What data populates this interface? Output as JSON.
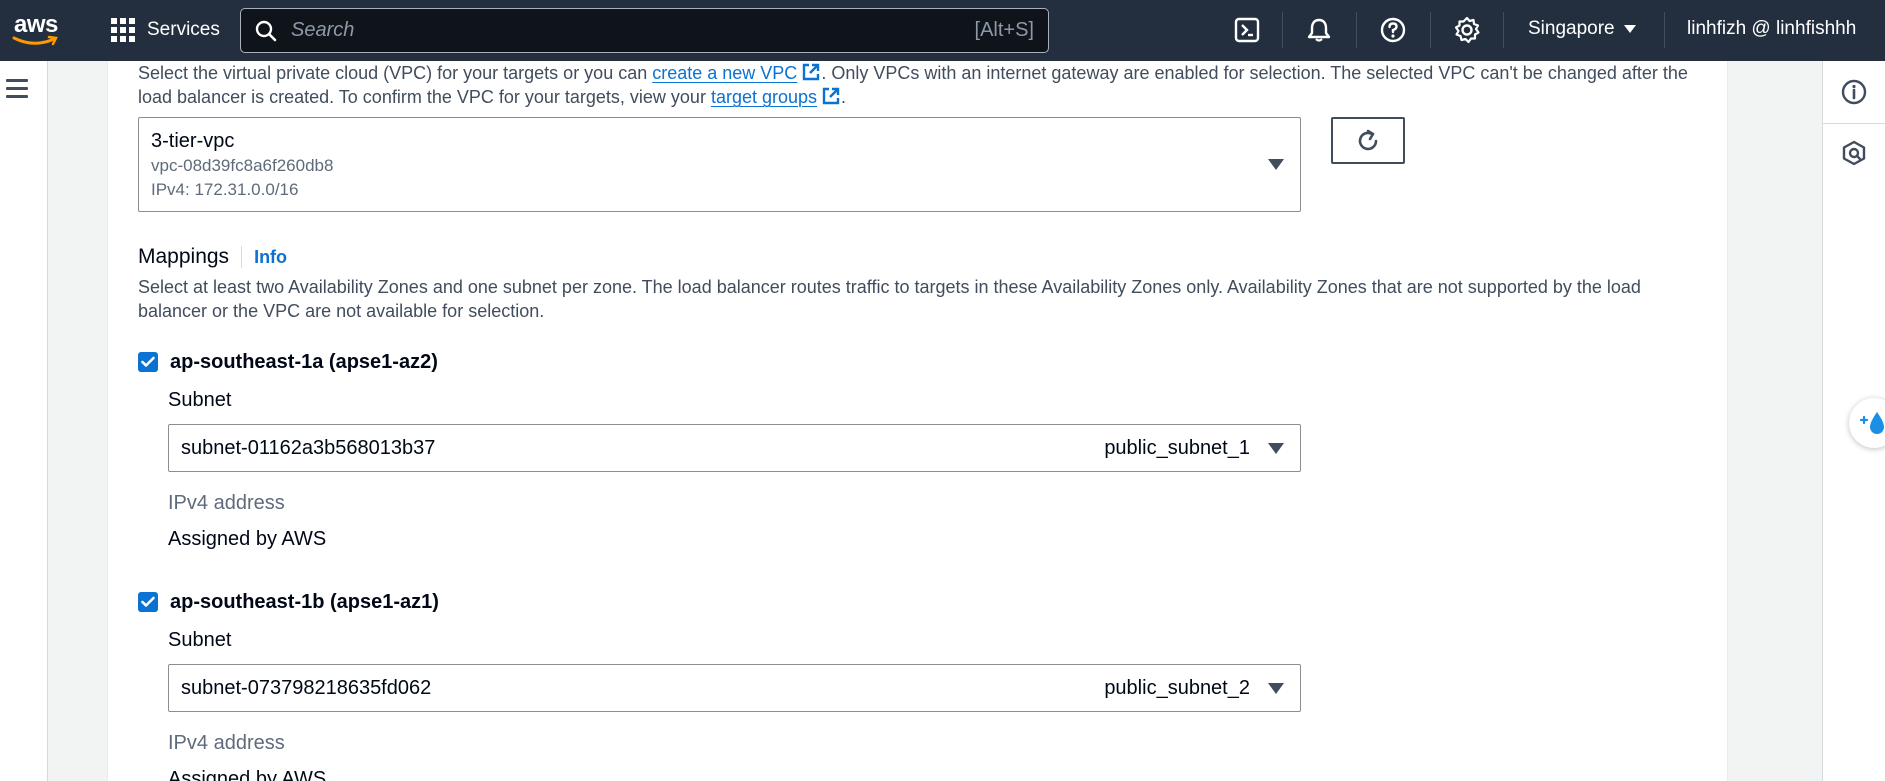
{
  "topnav": {
    "logo_text": "aws",
    "services_label": "Services",
    "search_placeholder": "Search",
    "search_shortcut": "[Alt+S]",
    "region": "Singapore",
    "account": "linhfizh @ linhfishhh"
  },
  "icons": {
    "grid": "grid-icon",
    "search": "search-icon",
    "cloudshell": "terminal-icon",
    "notifications": "bell-icon",
    "help": "help-icon",
    "settings": "gear-icon",
    "menu": "menu-icon",
    "info": "info-icon",
    "feedback": "feedback-icon",
    "refresh": "refresh-icon",
    "external_link": "external-link-icon"
  },
  "colors": {
    "nav_bg": "#232f3e",
    "link": "#0972d3",
    "checkbox": "#0972d3"
  },
  "vpc": {
    "desc_part1": "Select the virtual private cloud (VPC) for your targets or you can ",
    "create_vpc_link": "create a new VPC",
    "desc_part2": ". Only VPCs with an internet gateway are enabled for selection. The selected VPC can't be changed after the load balancer is created. To confirm the VPC for your targets, view your ",
    "target_groups_link": "target groups",
    "desc_part3": ".",
    "selected_name": "3-tier-vpc",
    "selected_id": "vpc-08d39fc8a6f260db8",
    "selected_cidr": "IPv4: 172.31.0.0/16"
  },
  "mappings": {
    "title": "Mappings",
    "info_label": "Info",
    "description": "Select at least two Availability Zones and one subnet per zone. The load balancer routes traffic to targets in these Availability Zones only. Availability Zones that are not supported by the load balancer or the VPC are not available for selection.",
    "zones": [
      {
        "label": "ap-southeast-1a (apse1-az2)",
        "checked": true,
        "subnet_label": "Subnet",
        "subnet_id": "subnet-01162a3b568013b37",
        "subnet_name": "public_subnet_1",
        "ipv4_label": "IPv4 address",
        "ipv4_value": "Assigned by AWS"
      },
      {
        "label": "ap-southeast-1b (apse1-az1)",
        "checked": true,
        "subnet_label": "Subnet",
        "subnet_id": "subnet-073798218635fd062",
        "subnet_name": "public_subnet_2",
        "ipv4_label": "IPv4 address",
        "ipv4_value": "Assigned by AWS"
      }
    ]
  }
}
